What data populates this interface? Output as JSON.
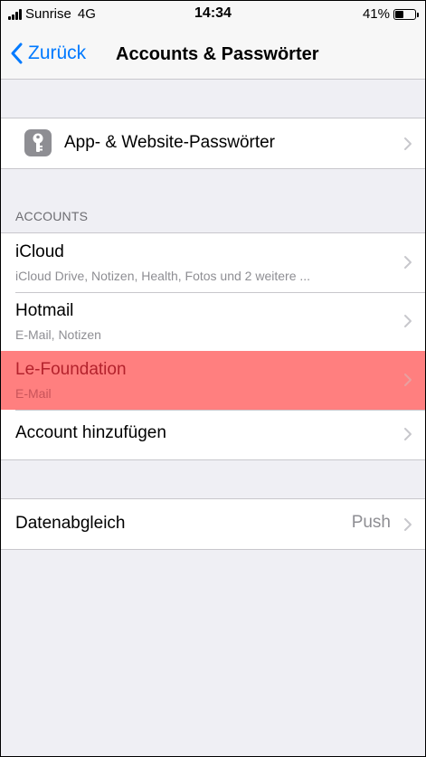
{
  "status_bar": {
    "carrier": "Sunrise",
    "network": "4G",
    "time": "14:34",
    "battery": "41%",
    "battery_level": 0.41
  },
  "nav": {
    "back_label": "Zurück",
    "title": "Accounts & Passwörter"
  },
  "passwords_row": {
    "label": "App- & Website-Passwörter",
    "icon": "key-icon"
  },
  "accounts_section": {
    "header": "ACCOUNTS",
    "items": [
      {
        "title": "iCloud",
        "subtitle": "iCloud Drive, Notizen, Health, Fotos und 2 weitere ..."
      },
      {
        "title": "Hotmail",
        "subtitle": "E-Mail, Notizen"
      },
      {
        "title": "Le-Foundation",
        "subtitle": "E-Mail",
        "highlighted": true
      }
    ],
    "add_account_label": "Account hinzufügen"
  },
  "fetch_row": {
    "label": "Datenabgleich",
    "value": "Push"
  },
  "colors": {
    "accent": "#007aff",
    "highlight": "#ff7f7f",
    "background": "#efeff4"
  }
}
